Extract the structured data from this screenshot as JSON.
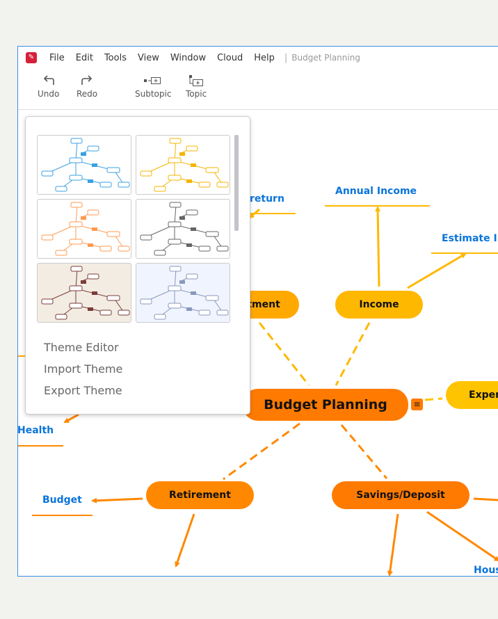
{
  "menubar": {
    "items": [
      "File",
      "Edit",
      "Tools",
      "View",
      "Window",
      "Cloud",
      "Help"
    ],
    "document_title": "Budget Planning"
  },
  "toolbar": {
    "undo": "Undo",
    "redo": "Redo",
    "subtopic": "Subtopic",
    "topic": "Topic"
  },
  "theme_popup": {
    "menu": [
      "Theme Editor",
      "Import Theme",
      "Export Theme"
    ],
    "themes": [
      {
        "bg": "#ffffff",
        "accent": "#3aa0e0"
      },
      {
        "bg": "#ffffff",
        "accent": "#f5b400"
      },
      {
        "bg": "#ffffff",
        "accent": "#ff9a50"
      },
      {
        "bg": "#ffffff",
        "accent": "#666666"
      },
      {
        "bg": "#f3ece2",
        "accent": "#7a3b3b"
      },
      {
        "bg": "#f0f4ff",
        "accent": "#8899bb"
      }
    ]
  },
  "map": {
    "central": "Budget Planning",
    "topics": {
      "investment": "Investment",
      "income": "Income",
      "expenses": "Expenses",
      "retirement": "Retirement",
      "savings": "Savings/Deposit"
    },
    "subtopics": {
      "return": "return",
      "annual_income": "Annual Income",
      "estimate": "Estimate I",
      "health": "Health",
      "budget": "Budget",
      "house": "Hous"
    },
    "colors": {
      "central": "#ff7a00",
      "income": "#ffb800",
      "investment": "#ffa800",
      "expenses": "#ffc400",
      "retirement": "#ff8800",
      "savings": "#ff7a00",
      "label": "#0a74da"
    }
  }
}
